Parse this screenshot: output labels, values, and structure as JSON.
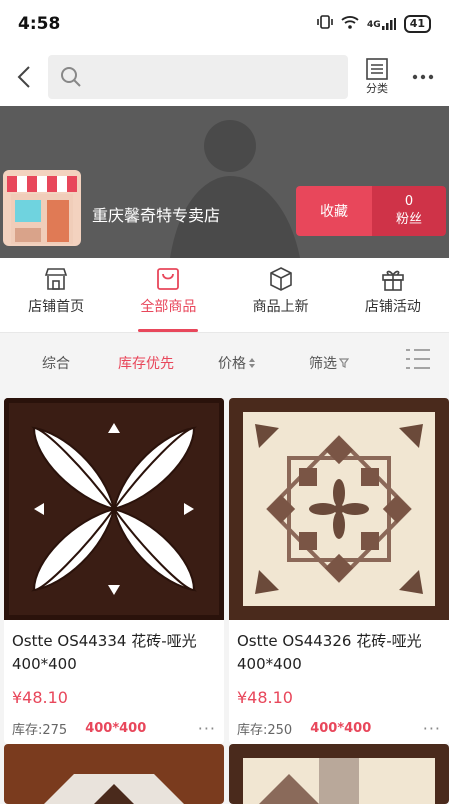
{
  "status": {
    "time": "4:58",
    "network": "4G",
    "battery": "41"
  },
  "nav": {
    "category_label": "分类"
  },
  "store": {
    "name": "重庆馨奇特专卖店",
    "fav_label": "收藏",
    "fans_count": "0",
    "fans_label": "粉丝"
  },
  "tabs": [
    {
      "label": "店铺首页",
      "icon": "store-icon"
    },
    {
      "label": "全部商品",
      "icon": "bag-icon",
      "active": true
    },
    {
      "label": "商品上新",
      "icon": "box-icon"
    },
    {
      "label": "店铺活动",
      "icon": "gift-icon"
    }
  ],
  "sort": {
    "general": "综合",
    "stock_first": "库存优先",
    "price": "价格",
    "filter": "筛选"
  },
  "products": [
    {
      "title": "Ostte OS44334 花砖-哑光 400*400",
      "price": "¥48.10",
      "stock": "库存:275",
      "size": "400*400"
    },
    {
      "title": "Ostte OS44326 花砖-哑光 400*400",
      "price": "¥48.10",
      "stock": "库存:250",
      "size": "400*400"
    }
  ],
  "colors": {
    "accent": "#e8475b",
    "banner": "#5b5b5b"
  }
}
